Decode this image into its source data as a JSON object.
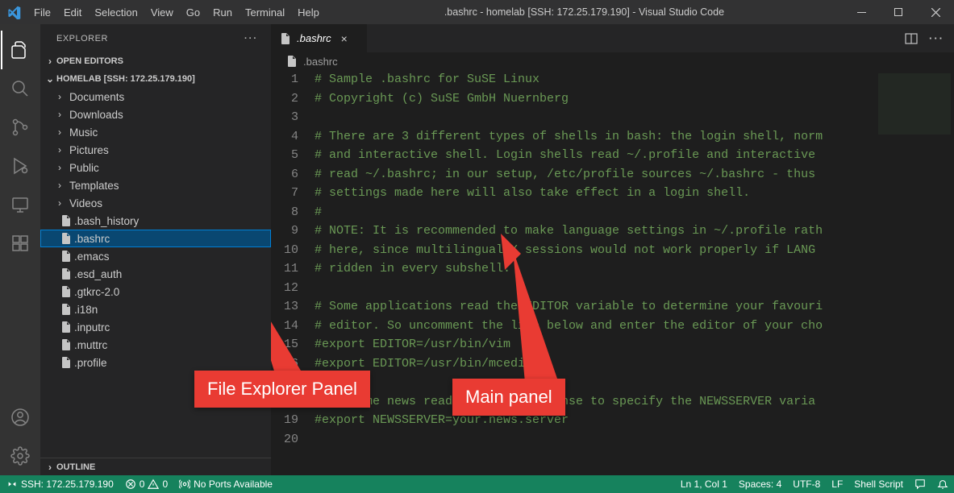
{
  "titlebar": {
    "menu": [
      "File",
      "Edit",
      "Selection",
      "View",
      "Go",
      "Run",
      "Terminal",
      "Help"
    ],
    "title": ".bashrc - homelab [SSH: 172.25.179.190] - Visual Studio Code"
  },
  "activity": {
    "items": [
      "explorer",
      "search",
      "source-control",
      "run-debug",
      "remote-explorer",
      "extensions"
    ],
    "bottom": [
      "accounts",
      "manage"
    ]
  },
  "sidebar": {
    "title": "EXPLORER",
    "open_editors": "OPEN EDITORS",
    "workspace_label": "HOMELAB [SSH: 172.25.179.190]",
    "folders": [
      "Documents",
      "Downloads",
      "Music",
      "Pictures",
      "Public",
      "Templates",
      "Videos"
    ],
    "files": [
      ".bash_history",
      ".bashrc",
      ".emacs",
      ".esd_auth",
      ".gtkrc-2.0",
      ".i18n",
      ".inputrc",
      ".muttrc",
      ".profile"
    ],
    "selected_file": ".bashrc",
    "outline": "OUTLINE"
  },
  "editor": {
    "tab_label": ".bashrc",
    "breadcrumb": ".bashrc",
    "lines": [
      "# Sample .bashrc for SuSE Linux",
      "# Copyright (c) SuSE GmbH Nuernberg",
      "",
      "# There are 3 different types of shells in bash: the login shell, norm",
      "# and interactive shell. Login shells read ~/.profile and interactive ",
      "# read ~/.bashrc; in our setup, /etc/profile sources ~/.bashrc - thus ",
      "# settings made here will also take effect in a login shell.",
      "#",
      "# NOTE: It is recommended to make language settings in ~/.profile rath",
      "# here, since multilingual X sessions would not work properly if LANG ",
      "# ridden in every subshell.",
      "",
      "# Some applications read the EDITOR variable to determine your favouri",
      "# editor. So uncomment the line below and enter the editor of your cho",
      "#export EDITOR=/usr/bin/vim",
      "#export EDITOR=/usr/bin/mcedit",
      "",
      "#For some news readers it makes sense to specify the NEWSSERVER varia",
      "#export NEWSSERVER=your.news.server",
      ""
    ]
  },
  "annotations": {
    "sidebar_label": "File Explorer Panel",
    "editor_label": "Main panel"
  },
  "status": {
    "remote": "SSH: 172.25.179.190",
    "errors": "0",
    "warnings": "0",
    "ports": "No Ports Available",
    "spaces": "Spaces: 4",
    "encoding": "UTF-8",
    "eol": "LF",
    "language": "Shell Script",
    "cursor": "Ln 1, Col 1"
  },
  "icons": {
    "chev_right": "›",
    "chev_down": "⌄",
    "ellipsis": "···"
  }
}
